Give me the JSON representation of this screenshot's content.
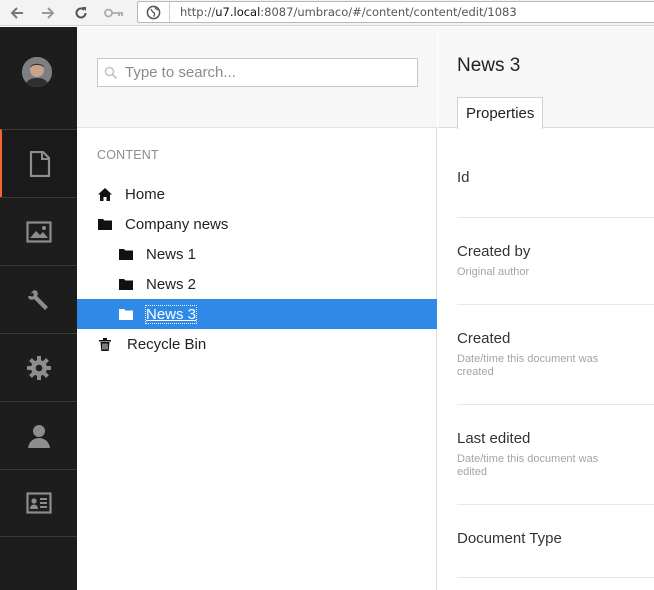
{
  "browser": {
    "url_prefix": "http://",
    "url_host": "u7.local",
    "url_rest": ":8087/umbraco/#/content/content/edit/1083"
  },
  "app_nav": {
    "accent_color": "#f5652d",
    "sections": [
      {
        "icon": "document-icon",
        "name": "content",
        "active": true
      },
      {
        "icon": "image-icon",
        "name": "media",
        "active": false
      },
      {
        "icon": "wrench-icon",
        "name": "developer",
        "active": false
      },
      {
        "icon": "gear-icon",
        "name": "settings",
        "active": false
      },
      {
        "icon": "user-icon",
        "name": "users",
        "active": false
      },
      {
        "icon": "id-card-icon",
        "name": "members",
        "active": false
      }
    ]
  },
  "tree": {
    "search_placeholder": "Type to search...",
    "section_title": "CONTENT",
    "selected_color": "#2e8ae6",
    "items": [
      {
        "label": "Home",
        "icon": "home-icon",
        "level": 0
      },
      {
        "label": "Company news",
        "icon": "folder-icon",
        "level": 0
      },
      {
        "label": "News 1",
        "icon": "folder-icon",
        "level": 1
      },
      {
        "label": "News 2",
        "icon": "folder-icon",
        "level": 1
      },
      {
        "label": "News 3",
        "icon": "folder-icon",
        "level": 1,
        "selected": true
      },
      {
        "label": "Recycle Bin",
        "icon": "trash-icon",
        "level": 0
      }
    ]
  },
  "editor": {
    "document_name": "News 3",
    "tab_label": "Properties",
    "properties": [
      {
        "label": "Id",
        "description": ""
      },
      {
        "label": "Created by",
        "description": "Original author"
      },
      {
        "label": "Created",
        "description": "Date/time this document was created"
      },
      {
        "label": "Last edited",
        "description": "Date/time this document was edited"
      },
      {
        "label": "Document Type",
        "description": ""
      }
    ]
  }
}
